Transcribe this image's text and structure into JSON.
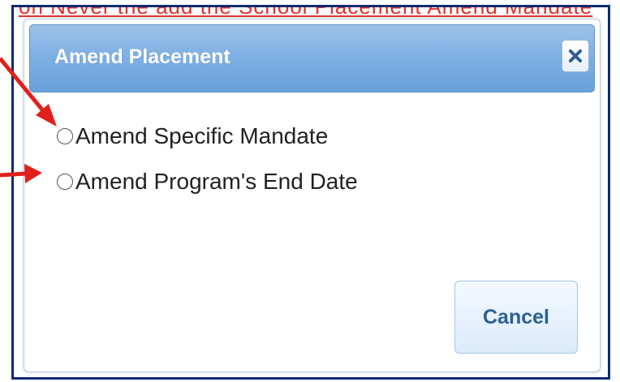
{
  "background": {
    "text": "on Never the add the School Placement Amend Mandate"
  },
  "dialog": {
    "title": "Amend Placement",
    "close_glyph": "×",
    "options": [
      {
        "label": "Amend Specific Mandate",
        "selected": false
      },
      {
        "label": "Amend Program's End Date",
        "selected": false
      }
    ],
    "cancel_label": "Cancel"
  },
  "colors": {
    "frame": "#0b2a6e",
    "titlebar": "#7fb0e3",
    "title_text": "#ffffff",
    "cancel_text": "#2b5f95",
    "arrow": "#e0201b",
    "background_text": "#e0312c"
  },
  "icons": {
    "close": "close-icon",
    "radio": "radio-icon",
    "arrow": "arrow-icon"
  }
}
